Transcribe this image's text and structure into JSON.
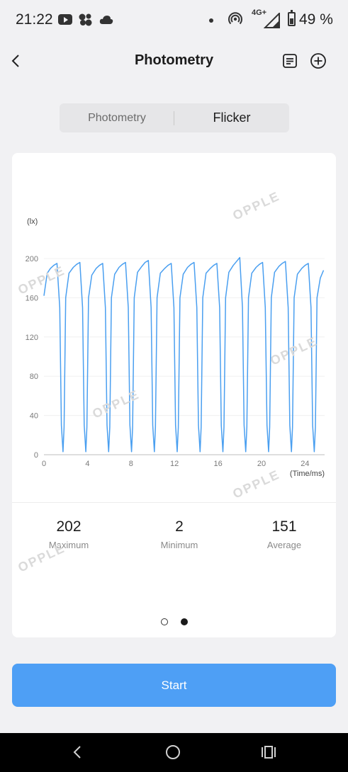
{
  "status_bar": {
    "time": "21:22",
    "network": "4G+",
    "battery": "49 %"
  },
  "header": {
    "title": "Photometry"
  },
  "tabs": [
    {
      "label": "Photometry"
    },
    {
      "label": "Flicker"
    }
  ],
  "watermark": "OPPLE",
  "stats": [
    {
      "value": "202",
      "label": "Maximum"
    },
    {
      "value": "2",
      "label": "Minimum"
    },
    {
      "value": "151",
      "label": "Average"
    }
  ],
  "start_button": "Start",
  "colors": {
    "accent": "#4e9ff5",
    "series": "#4a9ff0"
  },
  "chart_data": {
    "type": "line",
    "xlabel": "(Time/ms)",
    "ylabel": "(lx)",
    "xlim": [
      0,
      25.8
    ],
    "ylim": [
      0,
      200
    ],
    "x_ticks": [
      0,
      4,
      8,
      12,
      16,
      20,
      24
    ],
    "y_ticks": [
      0,
      40,
      80,
      120,
      160,
      200
    ],
    "grid": "horizontal",
    "period_ms": 2.1,
    "series": [
      {
        "x": [
          0,
          0.3,
          0.6,
          0.9,
          1.2,
          1.45,
          1.6,
          1.75,
          1.85,
          2.0,
          2.3,
          2.7,
          3.0,
          3.3,
          3.55,
          3.7,
          3.85,
          3.95,
          4.1,
          4.4,
          4.8,
          5.1,
          5.4,
          5.65,
          5.8,
          5.95,
          6.05,
          6.2,
          6.5,
          6.9,
          7.2,
          7.5,
          7.75,
          7.9,
          8.05,
          8.15,
          8.3,
          8.6,
          9.0,
          9.3,
          9.6,
          9.85,
          10.0,
          10.15,
          10.25,
          10.4,
          10.7,
          11.1,
          11.4,
          11.7,
          11.95,
          12.1,
          12.25,
          12.35,
          12.5,
          12.8,
          13.2,
          13.5,
          13.8,
          14.05,
          14.2,
          14.35,
          14.45,
          14.6,
          14.9,
          15.3,
          15.6,
          15.9,
          16.15,
          16.3,
          16.45,
          16.55,
          16.7,
          17.0,
          17.4,
          17.7,
          18.0,
          18.25,
          18.4,
          18.55,
          18.65,
          18.8,
          19.1,
          19.5,
          19.8,
          20.1,
          20.35,
          20.5,
          20.65,
          20.75,
          20.9,
          21.2,
          21.6,
          21.9,
          22.2,
          22.45,
          22.6,
          22.75,
          22.85,
          23.0,
          23.3,
          23.7,
          24.0,
          24.3,
          24.55,
          24.7,
          24.85,
          24.95,
          25.1,
          25.4,
          25.7
        ],
        "y": [
          162,
          185,
          190,
          193,
          195,
          150,
          30,
          3,
          28,
          160,
          185,
          191,
          194,
          196,
          150,
          30,
          3,
          28,
          160,
          183,
          190,
          193,
          195,
          150,
          30,
          3,
          28,
          160,
          184,
          191,
          194,
          196,
          150,
          30,
          3,
          28,
          160,
          186,
          192,
          196,
          198,
          150,
          30,
          3,
          28,
          160,
          185,
          190,
          193,
          195,
          150,
          30,
          3,
          28,
          160,
          184,
          191,
          194,
          196,
          150,
          30,
          3,
          28,
          160,
          185,
          190,
          193,
          195,
          150,
          30,
          3,
          28,
          160,
          186,
          193,
          197,
          201,
          150,
          30,
          3,
          28,
          160,
          185,
          191,
          194,
          196,
          150,
          30,
          3,
          28,
          160,
          186,
          192,
          195,
          197,
          150,
          30,
          3,
          28,
          160,
          184,
          190,
          193,
          195,
          150,
          30,
          3,
          28,
          160,
          180,
          188
        ]
      }
    ]
  }
}
